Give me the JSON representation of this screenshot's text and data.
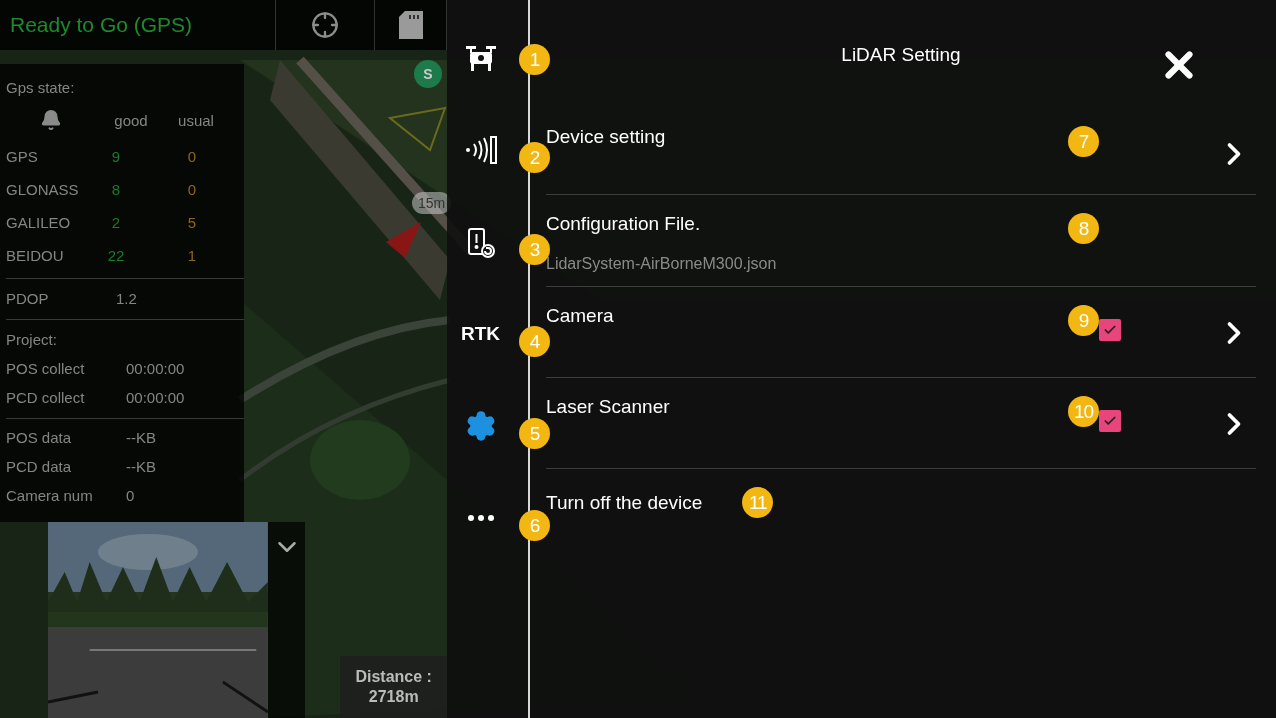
{
  "status_bar": {
    "status": "Ready to Go (GPS)"
  },
  "gps_panel": {
    "title": "Gps state:",
    "columns": [
      "good",
      "usual"
    ],
    "rows": [
      {
        "name": "GPS",
        "good": "9",
        "usual": "0"
      },
      {
        "name": "GLONASS",
        "good": "8",
        "usual": "0"
      },
      {
        "name": "GALILEO",
        "good": "2",
        "usual": "5"
      },
      {
        "name": "BEIDOU",
        "good": "22",
        "usual": "1"
      }
    ],
    "pdop": {
      "label": "PDOP",
      "value": "1.2"
    }
  },
  "project_panel": {
    "title": "Project:",
    "rows": [
      {
        "label": "POS collect",
        "value": "00:00:00"
      },
      {
        "label": "PCD collect",
        "value": "00:00:00"
      }
    ]
  },
  "data_panel": {
    "rows": [
      {
        "label": "POS data",
        "value": "--KB"
      },
      {
        "label": "PCD data",
        "value": "--KB"
      },
      {
        "label": "Camera num",
        "value": "0"
      }
    ]
  },
  "map": {
    "home_label": "S",
    "marker_label": "15m"
  },
  "flight_info": {
    "distance_label": "Distance :",
    "distance_value": "2718m"
  },
  "lidar_dialog": {
    "title": "LiDAR Setting",
    "sidebar": [
      {
        "kind": "drone",
        "callout": "1"
      },
      {
        "kind": "scanner",
        "callout": "2"
      },
      {
        "kind": "battery",
        "callout": "3"
      },
      {
        "kind": "text",
        "label": "RTK",
        "callout": "4"
      },
      {
        "kind": "gear",
        "callout": "5"
      },
      {
        "kind": "more",
        "callout": "6"
      }
    ],
    "rows": [
      {
        "kind": "link",
        "title": "Device setting",
        "callout": "7"
      },
      {
        "kind": "file",
        "title": "Configuration File.",
        "subtitle": "LidarSystem-AirBorneM300.json",
        "callout": "8"
      },
      {
        "kind": "toggle",
        "title": "Camera",
        "checked": true,
        "callout": "9"
      },
      {
        "kind": "toggle",
        "title": "Laser Scanner",
        "checked": true,
        "callout": "10"
      },
      {
        "kind": "action",
        "title": "Turn off the device",
        "callout": "11"
      }
    ]
  }
}
